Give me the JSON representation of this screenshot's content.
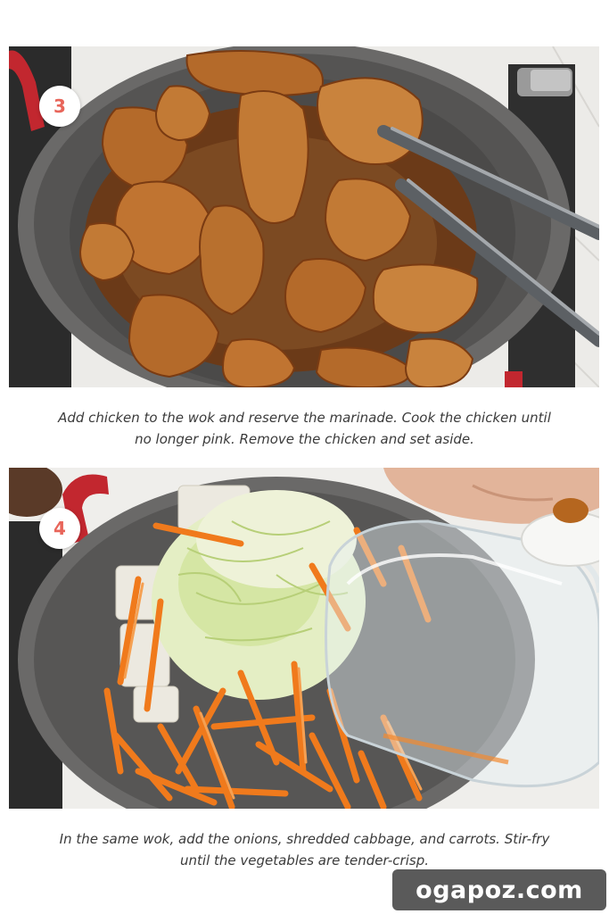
{
  "steps": [
    {
      "number": "3",
      "caption_line1": "Add chicken to the wok and reserve the marinade. Cook the chicken until",
      "caption_line2": "no longer pink. Remove the chicken and set aside."
    },
    {
      "number": "4",
      "caption_line1": "In the same wok, add the onions, shredded cabbage, and carrots. Stir-fry",
      "caption_line2": "until the vegetables are tender-crisp."
    }
  ],
  "watermark": "ogapoz.com",
  "colors": {
    "badge_number": "#e8655a",
    "wok": "#5c5b5a",
    "chicken": "#b4692a",
    "cabbage": "#dfeab8",
    "carrot": "#f07a1c",
    "watermark_bg": "#5a5a5a"
  }
}
